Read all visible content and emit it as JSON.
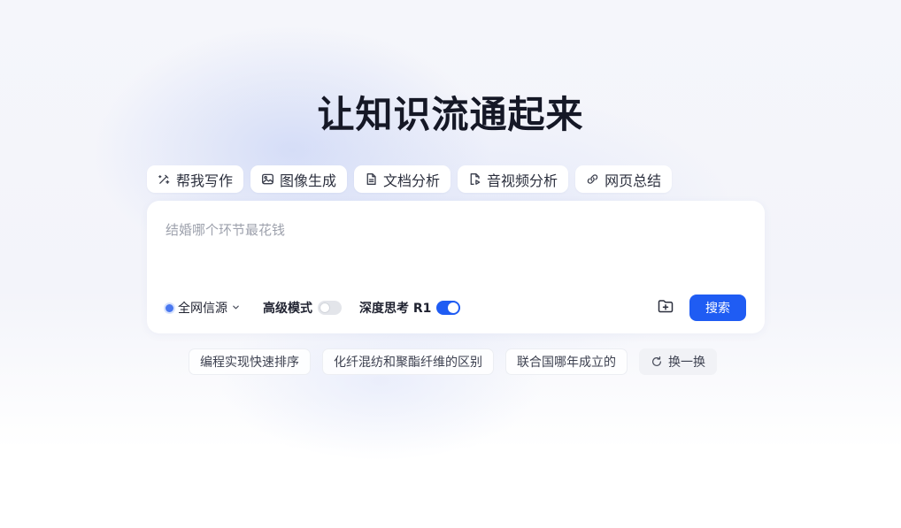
{
  "page": {
    "title": "让知识流通起来"
  },
  "tools": [
    {
      "label": "帮我写作",
      "icon": "pen-sparkle-icon"
    },
    {
      "label": "图像生成",
      "icon": "image-icon"
    },
    {
      "label": "文档分析",
      "icon": "document-icon"
    },
    {
      "label": "音视频分析",
      "icon": "audio-video-file-icon"
    },
    {
      "label": "网页总结",
      "icon": "link-icon"
    }
  ],
  "search": {
    "placeholder": "结婚哪个环节最花钱",
    "value": "",
    "source_label": "全网信源",
    "advanced_mode_label": "高级模式",
    "advanced_mode_on": false,
    "deep_think_label": "深度思考 R1",
    "deep_think_on": true,
    "submit_label": "搜索",
    "accent_color": "#1f5cf3"
  },
  "suggestions": {
    "items": [
      "编程实现快速排序",
      "化纤混纺和聚酯纤维的区别",
      "联合国哪年成立的"
    ],
    "refresh_label": "换一换"
  }
}
